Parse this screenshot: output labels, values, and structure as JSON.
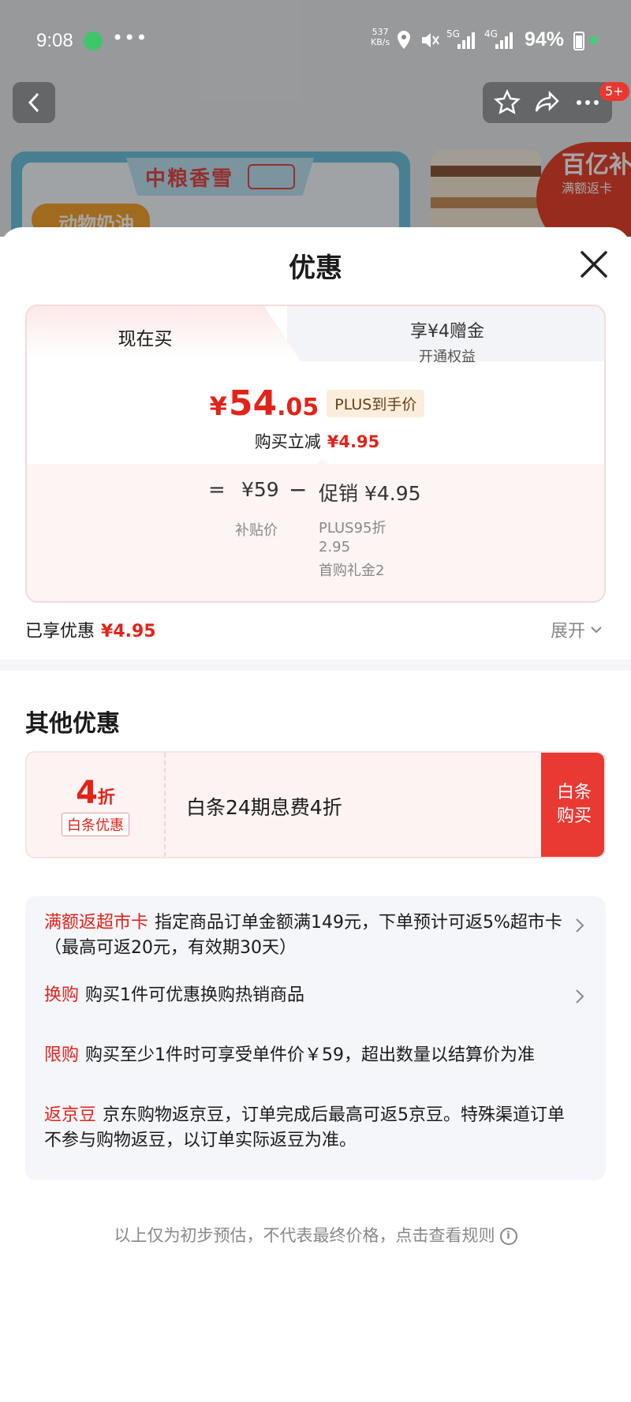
{
  "status_bar": {
    "time": "9:08",
    "dots": "•••",
    "speed_value": "537",
    "speed_unit": "KB/s",
    "net1": "5G",
    "net2": "4G",
    "battery": "94%"
  },
  "background": {
    "brand_name": "中粮香雪",
    "tag": "动物奶油",
    "subsidy_big": "百亿补贴",
    "subsidy_small": "满额返卡",
    "cart_badge": "5+"
  },
  "sheet": {
    "title": "优惠",
    "tabs": [
      {
        "label": "现在买",
        "active": true
      },
      {
        "label": "享¥4赠金",
        "sublabel": "开通权益",
        "active": false
      }
    ],
    "price": {
      "currency": "¥",
      "integer": "54",
      "decimal": ".05",
      "tag": "PLUS到手价"
    },
    "reduce": {
      "label": "购买立减",
      "amount": "¥4.95"
    },
    "breakdown": {
      "eq": "=",
      "base_value": "¥59",
      "base_label": "补贴价",
      "minus": "−",
      "promo_value": "促销 ¥4.95",
      "promo_details": [
        "PLUS95折",
        "2.95",
        "首购礼金2"
      ]
    },
    "enjoyed": {
      "label": "已享优惠",
      "amount": "¥4.95"
    },
    "expand_label": "展开"
  },
  "other": {
    "title": "其他优惠",
    "baitiao": {
      "discount_num": "4",
      "discount_unit": "折",
      "tag": "白条优惠",
      "desc": "白条24期息费4折",
      "button_line1": "白条",
      "button_line2": "购买"
    },
    "promos": [
      {
        "key": "满额返超市卡",
        "text": "指定商品订单金额满149元，下单预计可返5%超市卡（最高可返20元，有效期30天）",
        "has_arrow": true
      },
      {
        "key": "换购",
        "text": "购买1件可优惠换购热销商品",
        "has_arrow": true
      },
      {
        "key": "限购",
        "text": "购买至少1件时可享受单件价￥59，超出数量以结算价为准",
        "has_arrow": false
      },
      {
        "key": "返京豆",
        "text": "京东购物返京豆，订单完成后最高可返5京豆。特殊渠道订单不参与购物返豆，以订单实际返豆为准。",
        "has_arrow": false
      }
    ],
    "footer_note": "以上仅为初步预估，不代表最终价格，点击查看规则"
  },
  "colors": {
    "accent_red": "#e2231a",
    "button_red": "#e83a33",
    "plus_gold_bg": "#fbeedc"
  }
}
